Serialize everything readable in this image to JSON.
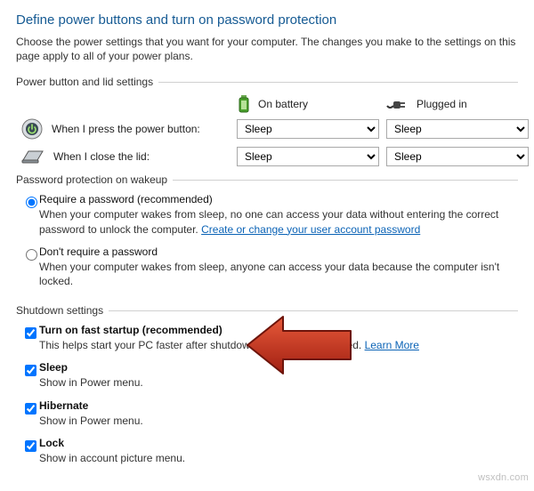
{
  "title": "Define power buttons and turn on password protection",
  "description": "Choose the power settings that you want for your computer. The changes you make to the settings on this page apply to all of your power plans.",
  "sections": {
    "power_lid": "Power button and lid settings",
    "password": "Password protection on wakeup",
    "shutdown": "Shutdown settings"
  },
  "columns": {
    "battery": "On battery",
    "plugged": "Plugged in"
  },
  "rows": {
    "power_button": {
      "label": "When I press the power button:",
      "battery": "Sleep",
      "plugged": "Sleep"
    },
    "close_lid": {
      "label": "When I close the lid:",
      "battery": "Sleep",
      "plugged": "Sleep"
    }
  },
  "password_opts": {
    "require": {
      "label": "Require a password (recommended)",
      "sub_pre": "When your computer wakes from sleep, no one can access your data without entering the correct password to unlock the computer. ",
      "link": "Create or change your user account password"
    },
    "dont": {
      "label": "Don't require a password",
      "sub": "When your computer wakes from sleep, anyone can access your data because the computer isn't locked."
    }
  },
  "shutdown_opts": {
    "fast_startup": {
      "label": "Turn on fast startup (recommended)",
      "sub_pre": "This helps start your PC faster after shutdown. Restart isn't affected. ",
      "link": "Learn More"
    },
    "sleep": {
      "label": "Sleep",
      "sub": "Show in Power menu."
    },
    "hibernate": {
      "label": "Hibernate",
      "sub": "Show in Power menu."
    },
    "lock": {
      "label": "Lock",
      "sub": "Show in account picture menu."
    }
  },
  "watermark": "wsxdn.com"
}
